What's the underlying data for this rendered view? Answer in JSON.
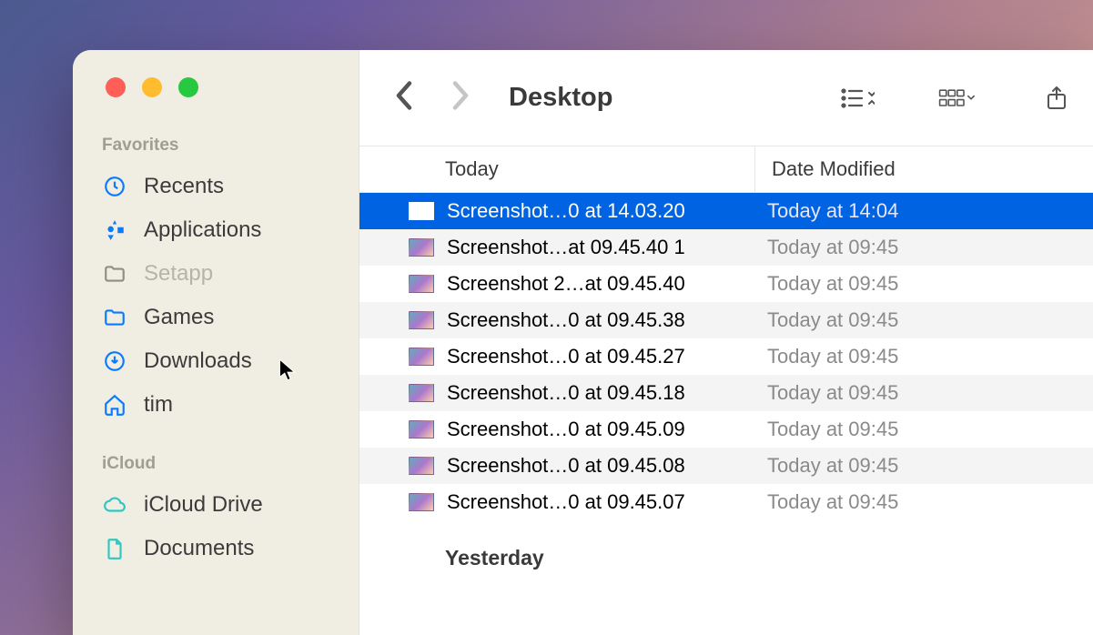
{
  "window": {
    "title": "Desktop"
  },
  "sidebar": {
    "sections": [
      {
        "label": "Favorites",
        "items": [
          {
            "id": "recents",
            "label": "Recents",
            "icon": "clock-icon"
          },
          {
            "id": "applications",
            "label": "Applications",
            "icon": "apps-icon"
          },
          {
            "id": "setapp",
            "label": "Setapp",
            "icon": "folder-icon",
            "dragged": true
          },
          {
            "id": "games",
            "label": "Games",
            "icon": "folder-icon"
          },
          {
            "id": "downloads",
            "label": "Downloads",
            "icon": "download-icon"
          },
          {
            "id": "tim",
            "label": "tim",
            "icon": "home-icon"
          }
        ]
      },
      {
        "label": "iCloud",
        "items": [
          {
            "id": "icloud-drive",
            "label": "iCloud Drive",
            "icon": "cloud-icon"
          },
          {
            "id": "documents",
            "label": "Documents",
            "icon": "doc-icon"
          }
        ]
      }
    ]
  },
  "columns": {
    "name": "Today",
    "date": "Date Modified"
  },
  "groups": [
    {
      "label": "Today",
      "files": [
        {
          "name": "Screenshot…0 at 14.03.20",
          "date": "Today at 14:04",
          "selected": true
        },
        {
          "name": "Screenshot…at 09.45.40 1",
          "date": "Today at 09:45"
        },
        {
          "name": "Screenshot 2…at 09.45.40",
          "date": "Today at 09:45"
        },
        {
          "name": "Screenshot…0 at 09.45.38",
          "date": "Today at 09:45"
        },
        {
          "name": "Screenshot…0 at 09.45.27",
          "date": "Today at 09:45"
        },
        {
          "name": "Screenshot…0 at 09.45.18",
          "date": "Today at 09:45"
        },
        {
          "name": "Screenshot…0 at 09.45.09",
          "date": "Today at 09:45"
        },
        {
          "name": "Screenshot…0 at 09.45.08",
          "date": "Today at 09:45"
        },
        {
          "name": "Screenshot…0 at 09.45.07",
          "date": "Today at 09:45"
        }
      ]
    },
    {
      "label": "Yesterday",
      "files": []
    }
  ],
  "colors": {
    "accent": "#0063e1",
    "sidebar_icon": "#0a7aff"
  }
}
